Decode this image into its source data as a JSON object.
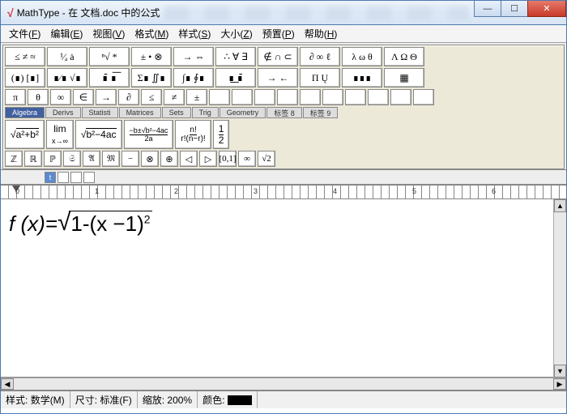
{
  "window": {
    "app_name": "MathType",
    "title_sep": " - ",
    "title_rest": "在 文档.doc 中的公式",
    "min": "—",
    "max": "☐",
    "close": "✕"
  },
  "menu": [
    {
      "label": "文件",
      "accel": "F"
    },
    {
      "label": "编辑",
      "accel": "E"
    },
    {
      "label": "视图",
      "accel": "V"
    },
    {
      "label": "格式",
      "accel": "M"
    },
    {
      "label": "样式",
      "accel": "S"
    },
    {
      "label": "大小",
      "accel": "Z"
    },
    {
      "label": "预置",
      "accel": "P"
    },
    {
      "label": "帮助",
      "accel": "H"
    }
  ],
  "palette_row1": [
    "≤ ≠ ≈",
    "¹⁄ₐ ȧ",
    "ⁿ√ *",
    "± • ⊗",
    "→ ⇔",
    "∴ ∀ ∃",
    "∉ ∩ ⊂",
    "∂ ∞ ℓ",
    "λ ω θ",
    "Λ Ω Θ"
  ],
  "palette_row2": [
    "(∎) [∎]",
    "∎⁄∎ √∎",
    "∎̄ ∎͞",
    "Σ∎ ∬∎",
    "∫∎ ∮∎",
    "∎͟ ∎̄",
    "→ ←",
    "Π Ų",
    "∎∎∎",
    "▦"
  ],
  "palette_row3": [
    "π",
    "θ",
    "∞",
    "∈",
    "→",
    "∂",
    "≤",
    "≠",
    "±",
    "",
    "",
    "",
    "",
    "",
    "",
    "",
    "",
    "",
    ""
  ],
  "tabs": [
    "Algebra",
    "Derivs",
    "Statisti",
    "Matrices",
    "Sets",
    "Trig",
    "Geometry",
    "标签 8",
    "标签 9"
  ],
  "active_tab": 0,
  "templates": [
    "√(a²+b²)",
    "lim x→∞",
    "√(b²−4ac)",
    "(−b±√(b²−4ac))/2a",
    "n! / r!(n−r)!",
    "1/2"
  ],
  "mini_row": [
    "ℤ",
    "ℝ",
    "ℙ",
    "𝔖",
    "𝔄",
    "𝔐",
    "−",
    "⊗",
    "⊕",
    "◁",
    "▷",
    "[0,1]",
    "∞",
    "√2"
  ],
  "slot_tab": "t",
  "ruler": {
    "marks": [
      "0",
      "1",
      "2",
      "3",
      "4",
      "5",
      "6"
    ]
  },
  "formula": {
    "lhs": "f (x)=",
    "inside": "1-(x −1)",
    "exp": "2"
  },
  "status": {
    "style_label": "样式:",
    "style_val": "数学(M)",
    "size_label": "尺寸:",
    "size_val": "标准(F)",
    "zoom_label": "缩放:",
    "zoom_val": "200%",
    "color_label": "颜色:"
  }
}
